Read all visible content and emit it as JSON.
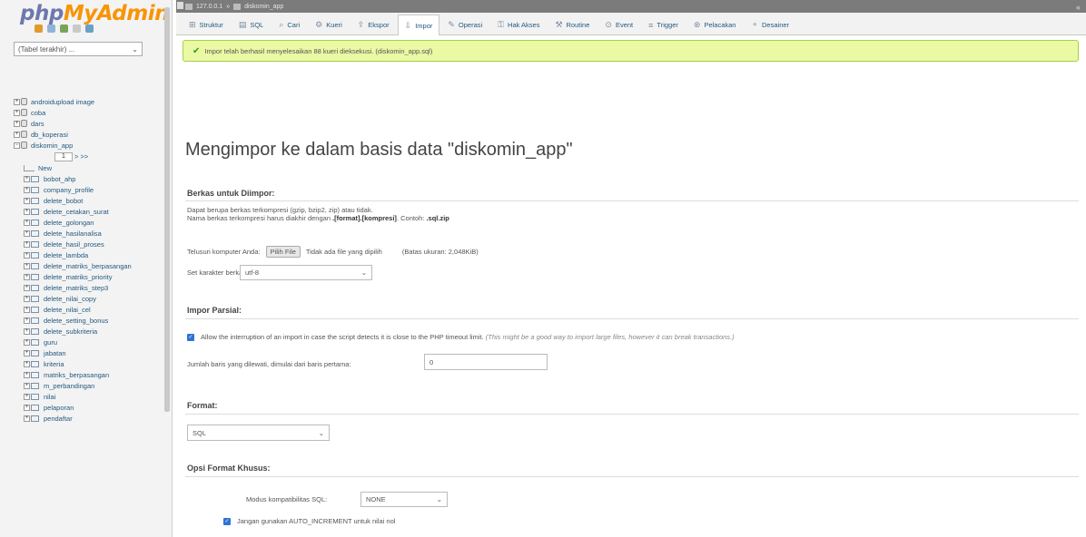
{
  "nav": {
    "logo_php": "php",
    "logo_myadmin": "MyAdmin",
    "recent_select": "(Tabel terakhir) ...",
    "databases": [
      {
        "name": "androidupload image"
      },
      {
        "name": "coba"
      },
      {
        "name": "dars"
      },
      {
        "name": "db_koperasi"
      },
      {
        "name": "diskomin_app"
      }
    ],
    "pager_value": "1",
    "pager_next": "> >>",
    "new_label": "New",
    "tables": [
      "bobot_ahp",
      "company_profile",
      "delete_bobot",
      "delete_cetakan_surat",
      "delete_golongan",
      "delete_hasilanalisa",
      "delete_hasil_proses",
      "delete_lambda",
      "delete_matriks_berpasangan",
      "delete_matriks_priority",
      "delete_matriks_step3",
      "delete_nilai_copy",
      "delete_nilai_cel",
      "delete_setting_bonus",
      "delete_subkriteria",
      "guru",
      "jabatan",
      "kriteria",
      "matriks_berpasangan",
      "m_perbandingan",
      "nilai",
      "pelaporan",
      "pendaftar"
    ]
  },
  "topbar": {
    "server": "127.0.0.1",
    "database": "diskomin_app",
    "collapse": "«"
  },
  "tabs": [
    {
      "label": "Struktur",
      "icon": "structure-icon",
      "glyph": "⊞"
    },
    {
      "label": "SQL",
      "icon": "sql-icon",
      "glyph": "▤"
    },
    {
      "label": "Cari",
      "icon": "search-icon",
      "glyph": "⌕"
    },
    {
      "label": "Kueri",
      "icon": "query-icon",
      "glyph": "⚙"
    },
    {
      "label": "Ekspor",
      "icon": "export-icon",
      "glyph": "⇪"
    },
    {
      "label": "Impor",
      "icon": "import-icon",
      "glyph": "⇩",
      "active": true
    },
    {
      "label": "Operasi",
      "icon": "wrench-icon",
      "glyph": "✎"
    },
    {
      "label": "Hak Akses",
      "icon": "privileges-icon",
      "glyph": "⚿"
    },
    {
      "label": "Routine",
      "icon": "routine-icon",
      "glyph": "⚒"
    },
    {
      "label": "Event",
      "icon": "event-icon",
      "glyph": "⊙"
    },
    {
      "label": "Trigger",
      "icon": "trigger-icon",
      "glyph": "≡"
    },
    {
      "label": "Pelacakan",
      "icon": "tracking-icon",
      "glyph": "⊛"
    },
    {
      "label": "Desainer",
      "icon": "designer-icon",
      "glyph": "⚬"
    }
  ],
  "success_message": "Impor telah berhasil menyelesaikan 88 kueri dieksekusi. (diskomin_app.sql)",
  "main_title": "Mengimpor ke dalam basis data \"diskomin_app\"",
  "file_section": {
    "title": "Berkas untuk Diimpor:",
    "line1": "Dapat berupa berkas terkompresi (gzip, bzip2, zip) atau tidak.",
    "line2_prefix": "Nama berkas terkompresi harus diakhir dengan",
    "line2_format": ".[format].[kompresi]",
    "line2_example_label": ". Contoh:",
    "line2_example": ".sql.zip",
    "upload_label": "Telusuri komputer Anda:",
    "choose_button": "Pilih File",
    "no_file": "Tidak ada file yang dipilih",
    "max_size": "(Batas ukuran: 2,048KiB)",
    "charset_label": "Set karakter berkas:",
    "charset_value": "utf-8"
  },
  "partial_section": {
    "title": "Impor Parsial:",
    "allow_interrupt": "Allow the interruption of an import in case the script detects it is close to the PHP timeout limit.",
    "allow_interrupt_note": "(This might be a good way to import large files, however it can break transactions.)",
    "skip_label": "Jumlah baris yang dilewati, dimulai dari baris pertama:",
    "skip_value": "0"
  },
  "format_section": {
    "title": "Format:",
    "value": "SQL"
  },
  "options_section": {
    "title": "Opsi Format Khusus:",
    "compat_label": "Modus kompatibilitas SQL:",
    "compat_value": "NONE",
    "auto_increment": "Jangan gunakan AUTO_INCREMENT untuk nilai nol"
  }
}
